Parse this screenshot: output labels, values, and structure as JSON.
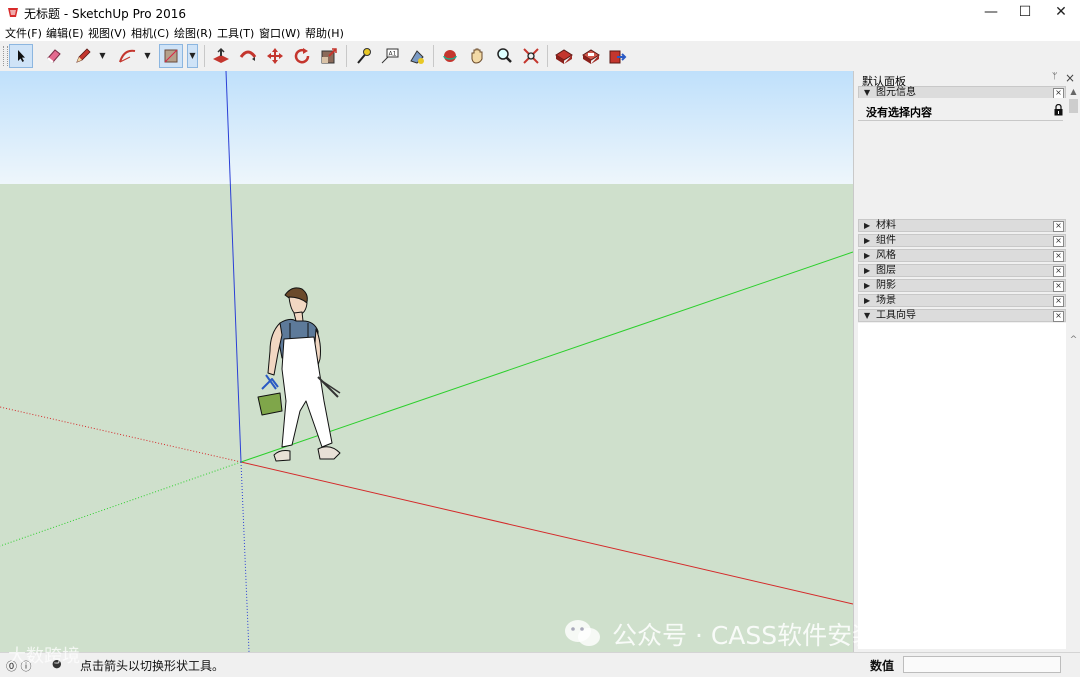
{
  "window": {
    "title": "无标题 - SketchUp Pro 2016",
    "minimize": "—",
    "maximize": "☐",
    "close": "✕"
  },
  "menu": [
    "文件(F)",
    "编辑(E)",
    "视图(V)",
    "相机(C)",
    "绘图(R)",
    "工具(T)",
    "窗口(W)",
    "帮助(H)"
  ],
  "toolbar": {
    "tools": [
      "select-icon",
      "eraser-icon",
      "pencil-icon",
      "arc-icon",
      "paint-bucket-icon",
      "push-pull-icon",
      "follow-me-icon",
      "move-icon",
      "rotate-icon",
      "scale-icon",
      "tape-measure-icon",
      "text-icon",
      "paint-icon",
      "orbit-icon",
      "pan-icon",
      "zoom-icon",
      "zoom-extents-icon",
      "warehouse-icon",
      "extension-icon",
      "send-icon"
    ],
    "active": "select-icon"
  },
  "panel": {
    "title": "默认面板",
    "pin": "ᛘ",
    "close": "×",
    "entity_info": {
      "label": "图元信息",
      "status": "没有选择内容"
    },
    "trays": [
      {
        "arrow": "▶",
        "label": "材料"
      },
      {
        "arrow": "▶",
        "label": "组件"
      },
      {
        "arrow": "▶",
        "label": "风格"
      },
      {
        "arrow": "▶",
        "label": "图层"
      },
      {
        "arrow": "▶",
        "label": "阴影"
      },
      {
        "arrow": "▶",
        "label": "场景"
      },
      {
        "arrow": "▼",
        "label": "工具向导"
      }
    ]
  },
  "status": {
    "hint": "点击箭头以切换形状工具。",
    "value_label": "数值",
    "value": ""
  },
  "watermarks": {
    "main": "公众号 · CASS软件安装管家助手",
    "left": "大数跨境"
  },
  "colors": {
    "sky": "#d6ebfa",
    "ground": "#cfe0cc",
    "axis_red": "#d42a2a",
    "axis_green": "#2ccf2c",
    "axis_blue": "#2b3fd6"
  }
}
